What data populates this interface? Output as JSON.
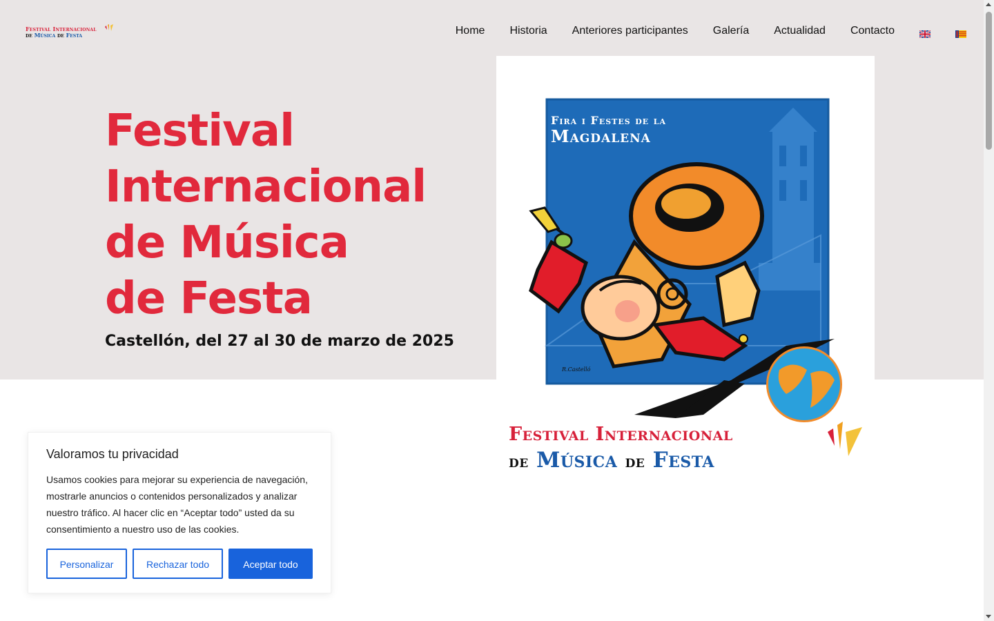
{
  "logo": {
    "line1": "Festival Internacional",
    "line2_a": "de",
    "line2_b": "Música",
    "line2_c": "de",
    "line2_d": "Festa"
  },
  "nav": {
    "items": [
      {
        "label": "Home"
      },
      {
        "label": "Historia"
      },
      {
        "label": "Anteriores participantes"
      },
      {
        "label": "Galería"
      },
      {
        "label": "Actualidad"
      },
      {
        "label": "Contacto"
      }
    ],
    "flags": [
      "english-flag-icon",
      "valencian-flag-icon"
    ]
  },
  "hero": {
    "title_lines": [
      "Festival",
      "Internacional",
      "de Música",
      "de Festa"
    ],
    "subtitle": "Castellón, del 27 al 30 de marzo de 2025",
    "title_color": "#e1293c",
    "background": "#e9e5e5"
  },
  "poster": {
    "header_line1": "Fira i Festes de la",
    "header_line2": "Magdalena",
    "signature": "R.Castelló",
    "bottom_line1": "Festival Internacional",
    "bottom_line2_a": "de",
    "bottom_line2_b": "Música",
    "bottom_line2_c": "de",
    "bottom_line2_d": "Festa"
  },
  "cookie_banner": {
    "title": "Valoramos tu privacidad",
    "body": "Usamos cookies para mejorar su experiencia de navegación, mostrarle anuncios o contenidos personalizados y analizar nuestro tráfico. Al hacer clic en “Aceptar todo” usted da su consentimiento a nuestro uso de las cookies.",
    "customize_label": "Personalizar",
    "reject_label": "Rechazar todo",
    "accept_label": "Aceptar todo",
    "accent": "#1863dc"
  }
}
